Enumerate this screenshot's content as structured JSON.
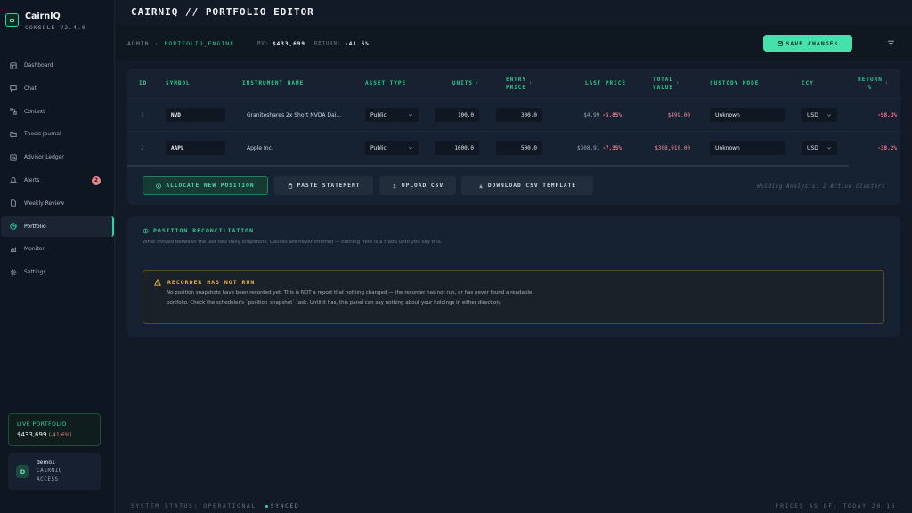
{
  "brand": {
    "name": "CairnIQ",
    "version": "CONSOLE V2.4.0"
  },
  "nav": [
    {
      "label": "Dashboard",
      "icon": "dashboard-icon"
    },
    {
      "label": "Chat",
      "icon": "chat-icon"
    },
    {
      "label": "Context",
      "icon": "context-icon"
    },
    {
      "label": "Thesis Journal",
      "icon": "journal-icon"
    },
    {
      "label": "Advisor Ledger",
      "icon": "ledger-icon"
    },
    {
      "label": "Alerts",
      "icon": "bell-icon",
      "badge": "2"
    },
    {
      "label": "Weekly Review",
      "icon": "document-icon"
    },
    {
      "label": "Portfolio",
      "icon": "pie-icon",
      "active": true
    },
    {
      "label": "Monitor",
      "icon": "monitor-icon"
    },
    {
      "label": "Settings",
      "icon": "gear-icon"
    }
  ],
  "live_portfolio": {
    "title": "LIVE PORTFOLIO",
    "value": "$433,699",
    "change": "(-41.6%)"
  },
  "user": {
    "initial": "D",
    "name": "demo1",
    "role_line1": "CAIRNIQ",
    "role_line2": "ACCESS"
  },
  "page_title": "CAIRNIQ // PORTFOLIO EDITOR",
  "breadcrumb": {
    "root": "ADMIN",
    "sep": "›",
    "current": "PORTFOLIO_ENGINE",
    "mv_label": "MV:",
    "mv_value": "$433,699",
    "return_label": "RETURN:",
    "return_value": "-41.6%"
  },
  "save_label": "SAVE CHANGES",
  "table": {
    "headers": {
      "id": "ID",
      "symbol": "SYMBOL",
      "instrument": "INSTRUMENT NAME",
      "asset_type": "ASSET TYPE",
      "units": "UNITS",
      "entry_1": "ENTRY",
      "entry_2": "PRICE",
      "last_price": "LAST PRICE",
      "total_1": "TOTAL",
      "total_2": "VALUE",
      "custody": "CUSTODY NODE",
      "ccy": "CCY",
      "return_1": "RETURN",
      "return_2": "%",
      "sort_glyph": "↕"
    },
    "rows": [
      {
        "id": "1",
        "symbol": "NVD",
        "instrument": "Graniteshares 2x Short NVDA Dai...",
        "asset_type": "Public",
        "units": "100.0",
        "entry_price": "300.0",
        "last_price": "$4.99",
        "last_change": "-5.85%",
        "total_value": "$499.00",
        "custody": "Unknown",
        "ccy": "USD",
        "return": "-98.3%"
      },
      {
        "id": "2",
        "symbol": "AAPL",
        "instrument": "Apple Inc.",
        "asset_type": "Public",
        "units": "1000.0",
        "entry_price": "500.0",
        "last_price": "$308.91",
        "last_change": "-7.35%",
        "total_value": "$308,910.00",
        "custody": "Unknown",
        "ccy": "USD",
        "return": "-38.2%"
      }
    ]
  },
  "actions": {
    "allocate": "ALLOCATE NEW POSITION",
    "paste": "PASTE STATEMENT",
    "upload": "UPLOAD CSV",
    "download": "DOWNLOAD CSV TEMPLATE",
    "holding_note": "Holding Analysis: 2 Active Clusters"
  },
  "reconciliation": {
    "title": "POSITION RECONCILIATION",
    "subtitle": "What moved between the last two daily snapshots. Causes are never inferred — nothing here is a trade until you say it is.",
    "warning_title": "RECORDER HAS NOT RUN",
    "warning_body": "No position snapshots have been recorded yet. This is NOT a report that nothing changed — the recorder has not run, or has never found a readable portfolio. Check the scheduler's `position_snapshot` task. Until it has, this panel can say nothing about your holdings in either direction."
  },
  "footer": {
    "status": "SYSTEM STATUS: OPERATIONAL",
    "synced": "SYNCED",
    "prices_as_of": "PRICES AS OF: TODAY 20:16"
  },
  "colors": {
    "accent": "#2fd49e",
    "negative": "#f07e8a",
    "warning": "#f0b33c",
    "background": "#111a26"
  }
}
